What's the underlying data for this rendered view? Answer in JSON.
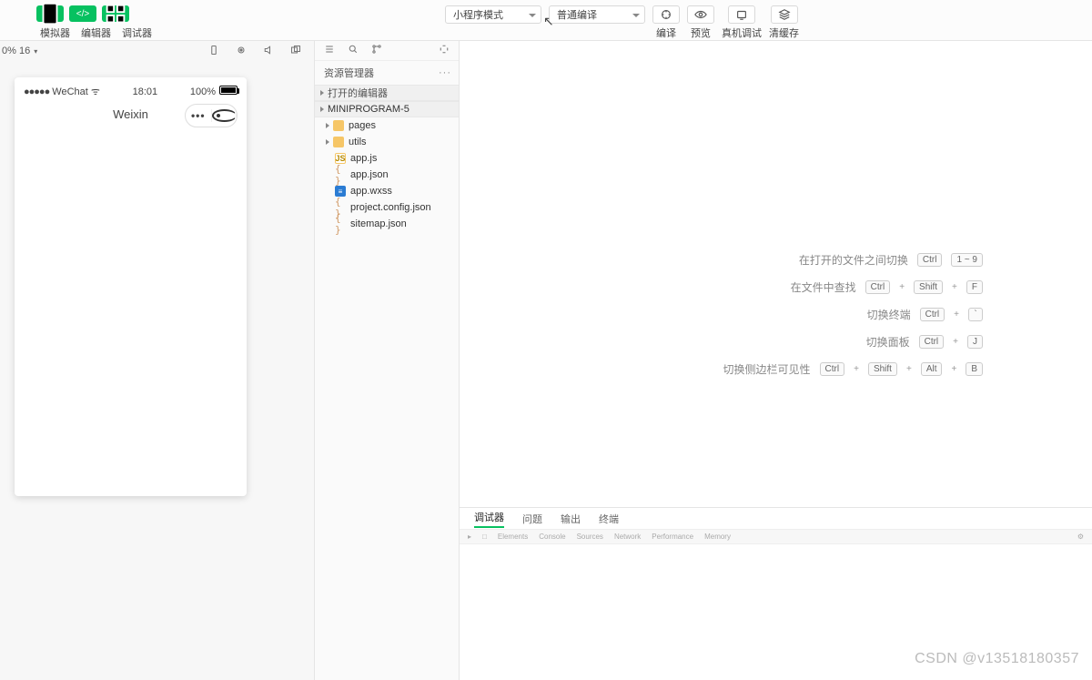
{
  "toolbar": {
    "labels": [
      "模拟器",
      "编辑器",
      "调试器"
    ],
    "mode_dropdown": "小程序模式",
    "compile_dropdown": "普通编译",
    "action_labels": [
      "编译",
      "预览",
      "真机调试",
      "清缓存"
    ]
  },
  "second_bar": {
    "zoom": "0% 16"
  },
  "phone": {
    "carrier": "WeChat",
    "dots": "●●●●●",
    "time": "18:01",
    "battery": "100%",
    "title": "Weixin",
    "menu_dots": "•••"
  },
  "explorer": {
    "title": "资源管理器",
    "open_editors": "打开的编辑器",
    "project": "MINIPROGRAM-5",
    "folders": [
      "pages",
      "utils"
    ],
    "files": [
      {
        "name": "app.js",
        "type": "js"
      },
      {
        "name": "app.json",
        "type": "json"
      },
      {
        "name": "app.wxss",
        "type": "wxss"
      },
      {
        "name": "project.config.json",
        "type": "json"
      },
      {
        "name": "sitemap.json",
        "type": "json"
      }
    ]
  },
  "welcome_shortcuts": [
    {
      "label": "在打开的文件之间切换",
      "keys": [
        "Ctrl",
        "1 ~ 9"
      ]
    },
    {
      "label": "在文件中查找",
      "keys": [
        "Ctrl",
        "+",
        "Shift",
        "+",
        "F"
      ]
    },
    {
      "label": "切换终端",
      "keys": [
        "Ctrl",
        "+",
        "`"
      ]
    },
    {
      "label": "切换面板",
      "keys": [
        "Ctrl",
        "+",
        "J"
      ]
    },
    {
      "label": "切换侧边栏可见性",
      "keys": [
        "Ctrl",
        "+",
        "Shift",
        "+",
        "Alt",
        "+",
        "B"
      ]
    }
  ],
  "bottom_panel": {
    "tabs": [
      "调试器",
      "问题",
      "输出",
      "终端"
    ]
  },
  "watermark": "CSDN @v13518180357"
}
